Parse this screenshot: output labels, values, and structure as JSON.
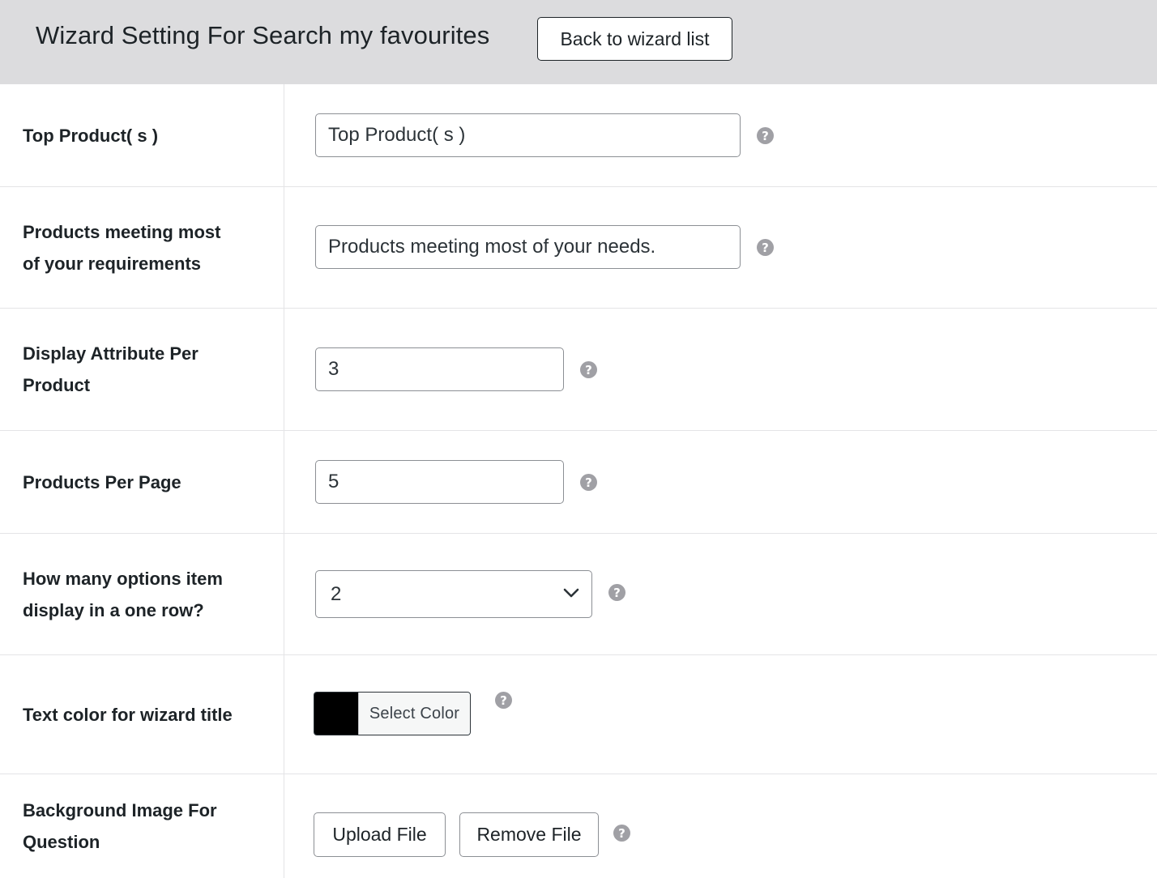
{
  "header": {
    "title": "Wizard Setting For Search my favourites",
    "back_label": "Back to wizard list"
  },
  "rows": {
    "top_products": {
      "label": "Top Product( s )",
      "value": "Top Product( s )"
    },
    "products_meeting": {
      "label_line1": "Products meeting most",
      "label_line2": "of your requirements",
      "value": "Products meeting most of your needs."
    },
    "attr_per_product": {
      "label_line1": "Display Attribute Per",
      "label_line2": "Product",
      "value": "3"
    },
    "products_per_page": {
      "label": "Products Per Page",
      "value": "5"
    },
    "options_per_row": {
      "label_line1": "How many options item",
      "label_line2": "display in a one row?",
      "selected": "2"
    },
    "title_color": {
      "label": "Text color for wizard title",
      "button_label": "Select Color",
      "color": "#000000"
    },
    "background_image": {
      "label_line1": "Background Image For",
      "label_line2": "Question",
      "upload_label": "Upload File",
      "remove_label": "Remove File"
    }
  },
  "help_glyph": "?",
  "icons": {
    "help": "question-circle-icon",
    "dropdown": "chevron-down-icon"
  },
  "colors": {
    "header_bg": "#dcdcde",
    "border": "#8c8f94",
    "help_icon": "#a0a0a5"
  }
}
